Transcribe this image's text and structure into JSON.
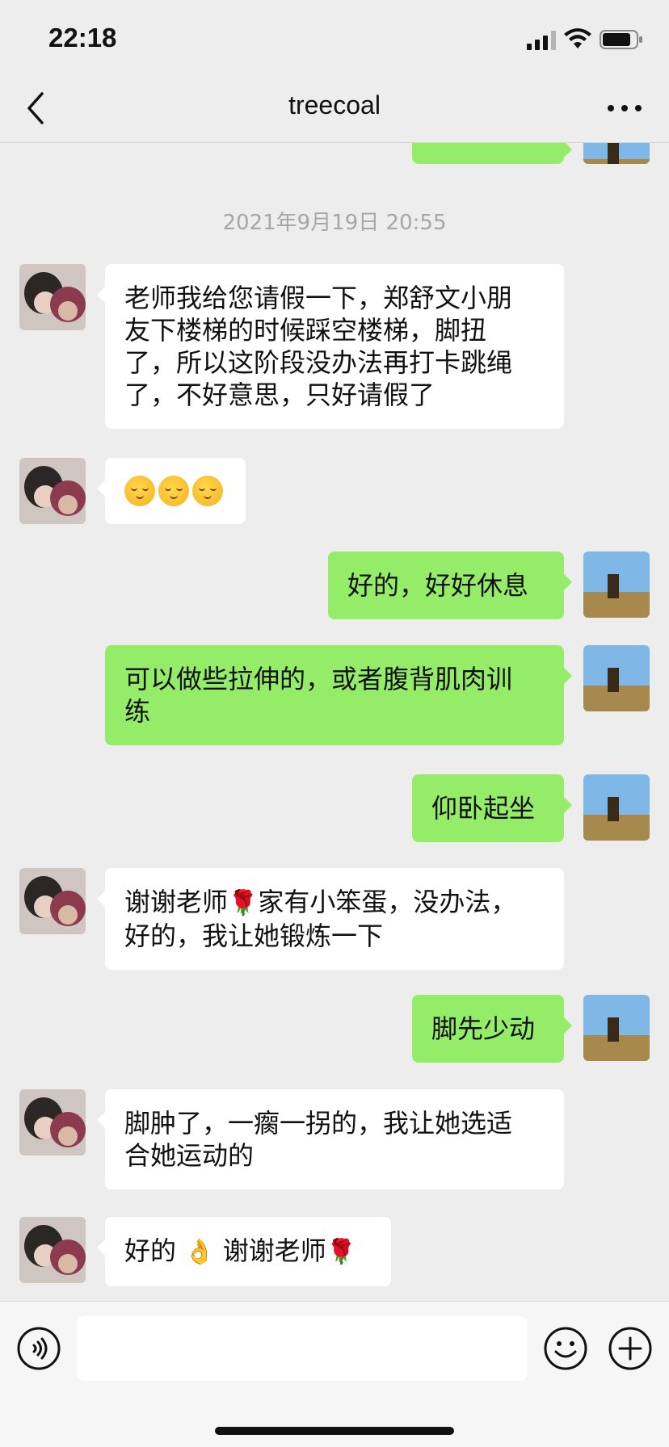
{
  "status": {
    "time": "22:18"
  },
  "nav": {
    "title": "treecoal",
    "back_icon": "chevron-left-icon",
    "more_icon": "more-dots-icon"
  },
  "chat": {
    "timestamp": "2021年9月19日 20:55",
    "messages": [
      {
        "side": "in",
        "lines": [
          "老师我给您请假一下，郑舒文小朋",
          "友下楼梯的时候踩空楼梯，脚扭",
          "了，所以这阶段没办法再打卡跳绳",
          "了，不好意思，只好请假了"
        ]
      },
      {
        "side": "in",
        "emoji": [
          "sad-face",
          "sad-face",
          "sad-face"
        ]
      },
      {
        "side": "out",
        "lines": [
          "好的，好好休息"
        ]
      },
      {
        "side": "out",
        "lines": [
          "可以做些拉伸的，或者腹背肌肉训",
          "练"
        ]
      },
      {
        "side": "out",
        "lines": [
          "仰卧起坐"
        ]
      },
      {
        "side": "in",
        "lines": [
          "谢谢老师",
          "家有小笨蛋，没办法，",
          "好的，我让她锻炼一下"
        ]
      },
      {
        "side": "out",
        "lines": [
          "脚先少动"
        ]
      },
      {
        "side": "in",
        "lines": [
          "脚肿了，一瘸一拐的，我让她选适",
          "合她运动的"
        ]
      },
      {
        "side": "in",
        "lines": [
          "好的",
          "谢谢老师"
        ]
      }
    ]
  },
  "input": {
    "placeholder": "",
    "voice_icon": "voice-icon",
    "emoji_icon": "emoji-icon",
    "plus_icon": "plus-icon"
  },
  "colors": {
    "background": "#ededed",
    "outgoing_bubble": "#95ec69",
    "incoming_bubble": "#ffffff",
    "timestamp": "#a6a6a6"
  }
}
